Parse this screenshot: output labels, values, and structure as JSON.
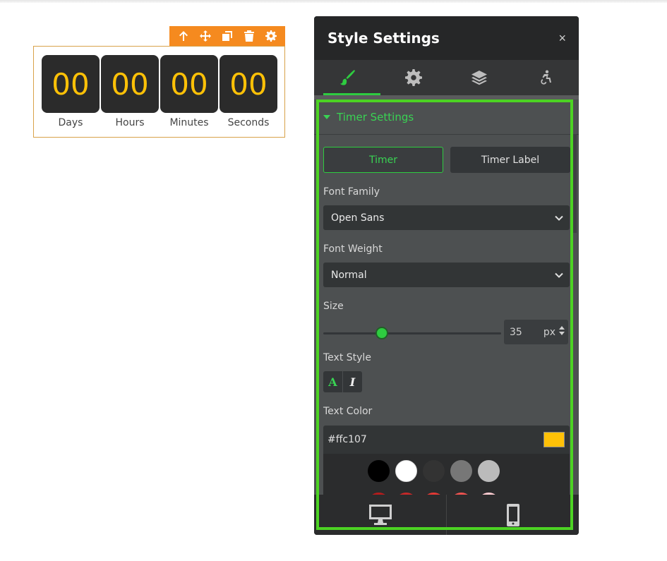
{
  "countdown": {
    "toolbar": {
      "icons": [
        "arrow-up-icon",
        "move-icon",
        "copy-icon",
        "trash-icon",
        "gear-icon"
      ]
    },
    "units": [
      {
        "value": "00",
        "label": "Days"
      },
      {
        "value": "00",
        "label": "Hours"
      },
      {
        "value": "00",
        "label": "Minutes"
      },
      {
        "value": "00",
        "label": "Seconds"
      }
    ],
    "digit_color": "#ffc107"
  },
  "panel": {
    "title": "Style Settings",
    "close": "×",
    "tabs": [
      {
        "icon": "brush-icon",
        "active": true
      },
      {
        "icon": "gear-icon",
        "active": false
      },
      {
        "icon": "layers-icon",
        "active": false
      },
      {
        "icon": "accessibility-icon",
        "active": false
      }
    ],
    "section": {
      "title": "Timer Settings",
      "segments": {
        "timer": "Timer",
        "timer_label": "Timer Label"
      },
      "font_family": {
        "label": "Font Family",
        "value": "Open Sans"
      },
      "font_weight": {
        "label": "Font Weight",
        "value": "Normal"
      },
      "size": {
        "label": "Size",
        "value": "35",
        "unit": "px",
        "slider_fraction": 0.33
      },
      "text_style": {
        "label": "Text Style",
        "bold": "A",
        "italic": "I"
      },
      "text_color": {
        "label": "Text Color",
        "value": "#ffc107"
      },
      "palette": [
        "#000000",
        "#ffffff",
        "#333333",
        "#777777",
        "#bbbbbb"
      ],
      "palette_second_row": [
        "#b71c1c",
        "#c62828",
        "#e53935",
        "#ef5350",
        "#ffcdd2"
      ]
    },
    "footer": {
      "devices": [
        "desktop-icon",
        "mobile-icon"
      ]
    },
    "accent": "#2ecc40"
  }
}
